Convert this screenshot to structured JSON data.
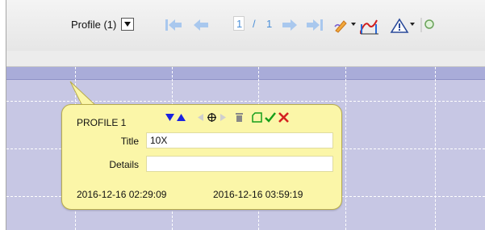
{
  "toolbar": {
    "profile_select_value": "Profile (1)",
    "current_page": "1",
    "page_separator": "/",
    "total_pages": "1",
    "icons": [
      "first-page-icon",
      "prev-page-icon",
      "next-page-icon",
      "last-page-icon",
      "pencil-icon",
      "curve-chart-icon",
      "warning-icon",
      "zoom-icon"
    ]
  },
  "callout": {
    "title": "PROFILE 1",
    "title_field_label": "Title",
    "title_field_value": "10X",
    "details_field_label": "Details",
    "details_field_value": "",
    "start_time": "2016-12-16 02:29:09",
    "end_time": "2016-12-16 03:59:19",
    "tool_icons": [
      "arrow-down-icon",
      "arrow-up-icon",
      "arrow-left-icon",
      "crosshair-icon",
      "arrow-right-icon",
      "trash-icon",
      "copy-icon",
      "check-icon",
      "close-icon"
    ]
  },
  "colors": {
    "plot_background": "#c7c7e4",
    "plot_band": "#a9acd9",
    "callout_background": "#fbf6a8",
    "accent_blue": "#1a22e0",
    "check_green": "#159e1a",
    "close_red": "#d42020"
  }
}
